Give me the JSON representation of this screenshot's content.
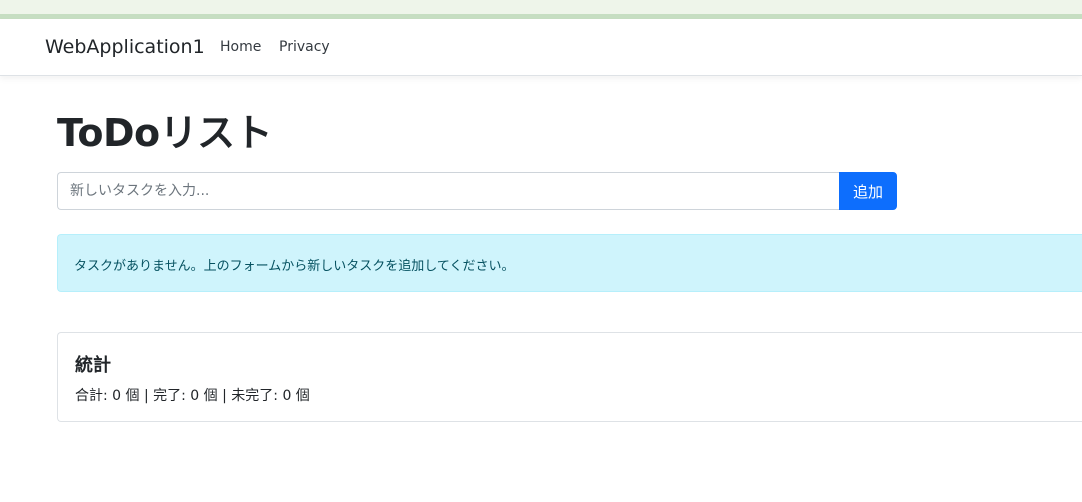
{
  "navbar": {
    "brand": "WebApplication1",
    "links": [
      {
        "label": "Home"
      },
      {
        "label": "Privacy"
      }
    ]
  },
  "main": {
    "title": "ToDoリスト",
    "task_input": {
      "value": "",
      "placeholder": "新しいタスクを入力..."
    },
    "add_button_label": "追加",
    "empty_alert": "タスクがありません。上のフォームから新しいタスクを追加してください。",
    "stats": {
      "title": "統計",
      "summary": "合計: 0 個 | 完了: 0 個 | 未完了: 0 個"
    }
  },
  "colors": {
    "primary": "#0d6efd",
    "info_bg": "#cff4fc",
    "info_text": "#055160"
  }
}
